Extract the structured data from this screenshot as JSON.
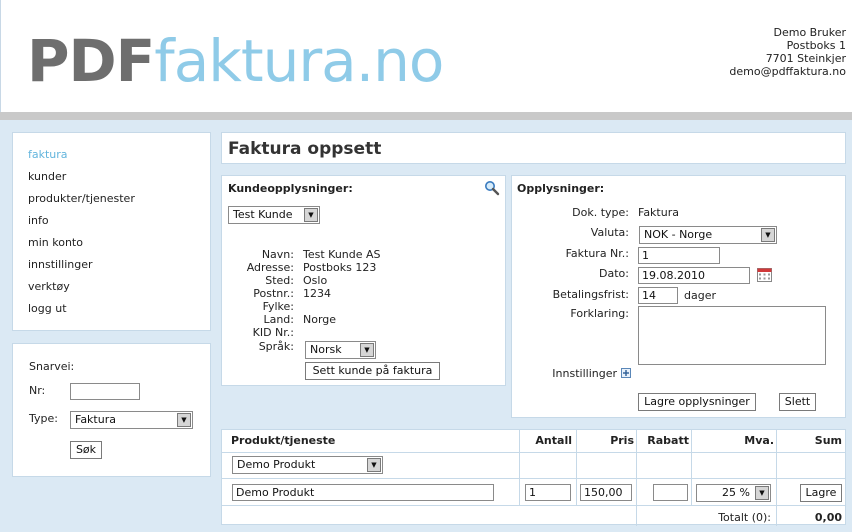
{
  "header": {
    "logo_pdf": "PDF",
    "logo_rest": "faktura.no",
    "company": {
      "name": "Demo Bruker",
      "address": "Postboks 1",
      "city": "7701 Steinkjer",
      "email": "demo@pdffaktura.no"
    }
  },
  "nav": {
    "items": [
      "faktura",
      "kunder",
      "produkter/tjenester",
      "info",
      "min konto",
      "innstillinger",
      "verktøy",
      "logg ut"
    ]
  },
  "shortcut": {
    "title": "Snarvei:",
    "nr_label": "Nr:",
    "nr_value": "",
    "type_label": "Type:",
    "type_value": "Faktura",
    "search_label": "Søk"
  },
  "page": {
    "title": "Faktura oppsett"
  },
  "customer": {
    "heading": "Kundeopplysninger:",
    "select_value": "Test Kunde",
    "fields": [
      {
        "label": "Navn:",
        "value": "Test Kunde AS"
      },
      {
        "label": "Adresse:",
        "value": "Postboks 123"
      },
      {
        "label": "Sted:",
        "value": "Oslo"
      },
      {
        "label": "Postnr.:",
        "value": "1234"
      },
      {
        "label": "Fylke:",
        "value": ""
      },
      {
        "label": "Land:",
        "value": "Norge"
      },
      {
        "label": "KID Nr.:",
        "value": ""
      }
    ],
    "language_label": "Språk:",
    "language_value": "Norsk",
    "set_button": "Sett kunde på faktura"
  },
  "info": {
    "heading": "Opplysninger:",
    "doc_type_label": "Dok. type:",
    "doc_type_value": "Faktura",
    "currency_label": "Valuta:",
    "currency_value": "NOK - Norge",
    "invoice_nr_label": "Faktura Nr.:",
    "invoice_nr_value": "1",
    "date_label": "Dato:",
    "date_value": "19.08.2010",
    "due_label": "Betalingsfrist:",
    "due_value": "14",
    "due_unit": "dager",
    "note_label": "Forklaring:",
    "note_value": "",
    "settings_label": "Innstillinger",
    "save_button": "Lagre opplysninger",
    "delete_button": "Slett"
  },
  "products": {
    "columns": [
      "Produkt/tjeneste",
      "Antall",
      "Pris",
      "Rabatt",
      "Mva.",
      "Sum"
    ],
    "select_value": "Demo Produkt",
    "row": {
      "name": "Demo Produkt",
      "quantity": "1",
      "price": "150,00",
      "discount": "",
      "vat": "25 %"
    },
    "save_button": "Lagre",
    "total_label": "Totalt (0):",
    "total_value": "0,00"
  },
  "colors": {
    "logo_gray": "#6e6e6e",
    "logo_blue": "#8fcbe8",
    "nav_active": "#63b5dd",
    "background": "#dbe9f4"
  },
  "icons": {
    "search": "magnifier-icon",
    "calendar": "calendar-icon",
    "expand": "plus-box-icon"
  }
}
